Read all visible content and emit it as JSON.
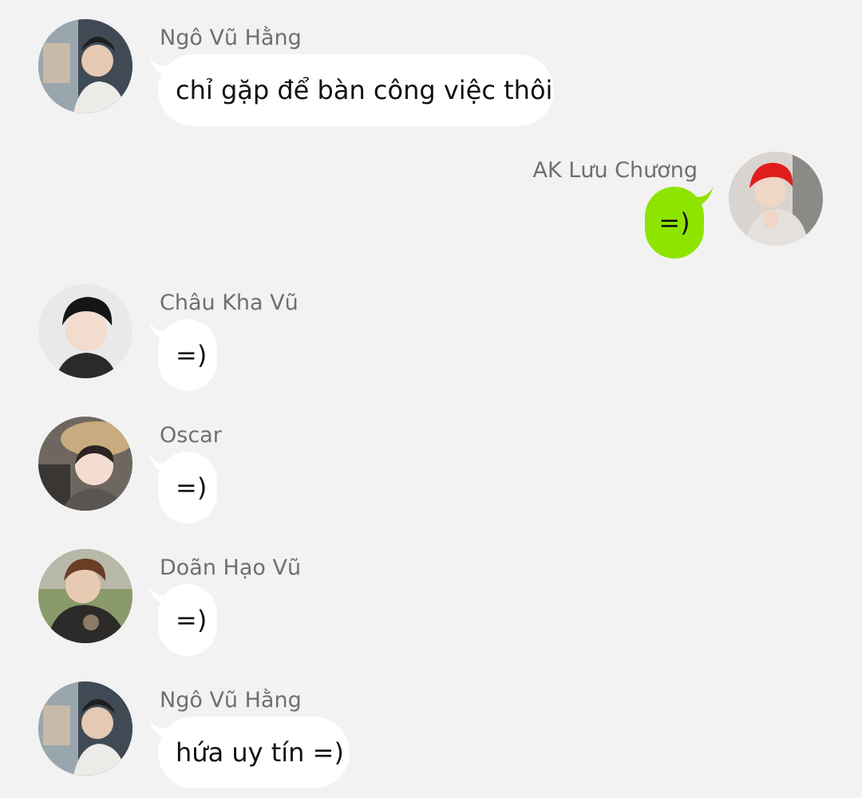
{
  "colors": {
    "background": "#f2f2f2",
    "incoming_bubble": "#ffffff",
    "outgoing_bubble": "#8ee400",
    "sender_name": "#6f6f6f",
    "message_text": "#111111"
  },
  "messages": [
    {
      "sender": "Ngô Vũ Hằng",
      "text": "chỉ gặp để bàn công việc thôi",
      "direction": "incoming"
    },
    {
      "sender": "AK Lưu Chương",
      "text": "=)",
      "direction": "outgoing"
    },
    {
      "sender": "Châu Kha Vũ",
      "text": "=)",
      "direction": "incoming"
    },
    {
      "sender": "Oscar",
      "text": "=)",
      "direction": "incoming"
    },
    {
      "sender": "Doãn Hạo Vũ",
      "text": "=)",
      "direction": "incoming"
    },
    {
      "sender": "Ngô Vũ Hằng",
      "text": "hứa uy tín =)",
      "direction": "incoming"
    }
  ]
}
